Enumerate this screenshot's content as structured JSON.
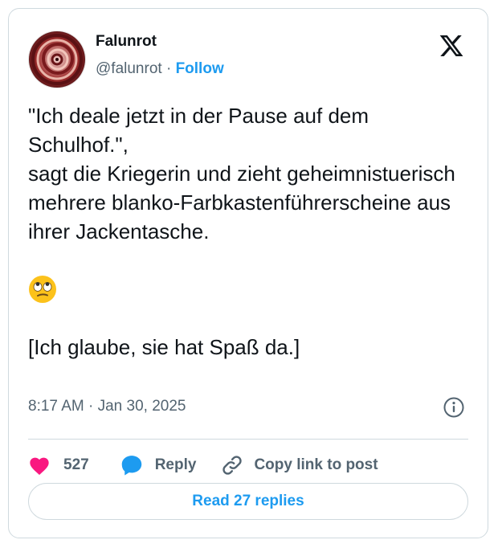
{
  "author": {
    "display_name": "Falunrot",
    "handle": "@falunrot",
    "separator": "·",
    "follow_label": "Follow"
  },
  "tweet": {
    "paragraph1": "\"Ich deale jetzt in der Pause auf dem Schulhof.\",\nsagt die Kriegerin und zieht geheimnistuerisch mehrere blanko-Farbkastenführerscheine aus ihrer Jackentasche.",
    "emoji": "face-with-rolling-eyes",
    "paragraph2": "[Ich glaube, sie hat Spaß da.]",
    "timestamp": "8:17 AM · Jan 30, 2025"
  },
  "actions": {
    "like_count": "527",
    "reply_label": "Reply",
    "copy_label": "Copy link to post"
  },
  "read_replies_label": "Read 27 replies",
  "colors": {
    "accent": "#1d9bf0",
    "like": "#f91880",
    "text": "#0f1419",
    "secondary": "#536471",
    "border": "#cfd9de"
  },
  "icons": {
    "logo": "x-logo-icon",
    "info": "info-icon",
    "like": "heart-icon",
    "reply": "speech-bubble-icon",
    "copy": "link-icon"
  }
}
